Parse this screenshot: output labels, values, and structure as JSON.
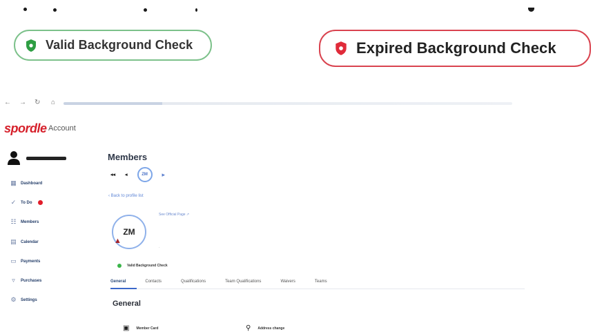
{
  "badges": {
    "valid": {
      "label": "Valid Background Check",
      "color": "#7cc18a",
      "icon": "shield-icon"
    },
    "expired": {
      "label": "Expired Background Check",
      "color": "#d9434f",
      "icon": "shield-icon"
    }
  },
  "app": {
    "logo": "spordle",
    "subtitle": "Account"
  },
  "sidebar": {
    "items": [
      {
        "icon": "dashboard-icon",
        "label": "Dashboard"
      },
      {
        "icon": "todo-icon",
        "label": "To Do"
      },
      {
        "icon": "members-icon",
        "label": "Members"
      },
      {
        "icon": "calendar-icon",
        "label": "Calendar"
      },
      {
        "icon": "payments-icon",
        "label": "Payments"
      },
      {
        "icon": "purchases-icon",
        "label": "Purchases"
      },
      {
        "icon": "settings-icon",
        "label": "Settings"
      }
    ]
  },
  "main": {
    "title": "Members",
    "pager": {
      "current": "ZM"
    },
    "back_link": "Back to profile list",
    "member": {
      "initials": "ZM",
      "official_link": "See Official Page"
    },
    "tabs": [
      "General",
      "Contacts",
      "Qualifications",
      "Team Qualifications",
      "Waivers",
      "Teams"
    ],
    "section_title": "General",
    "cards": [
      {
        "icon": "card-icon",
        "label": "Member Card"
      },
      {
        "icon": "location-icon",
        "label": "Address change"
      }
    ]
  },
  "browser": {
    "url_text": ""
  }
}
